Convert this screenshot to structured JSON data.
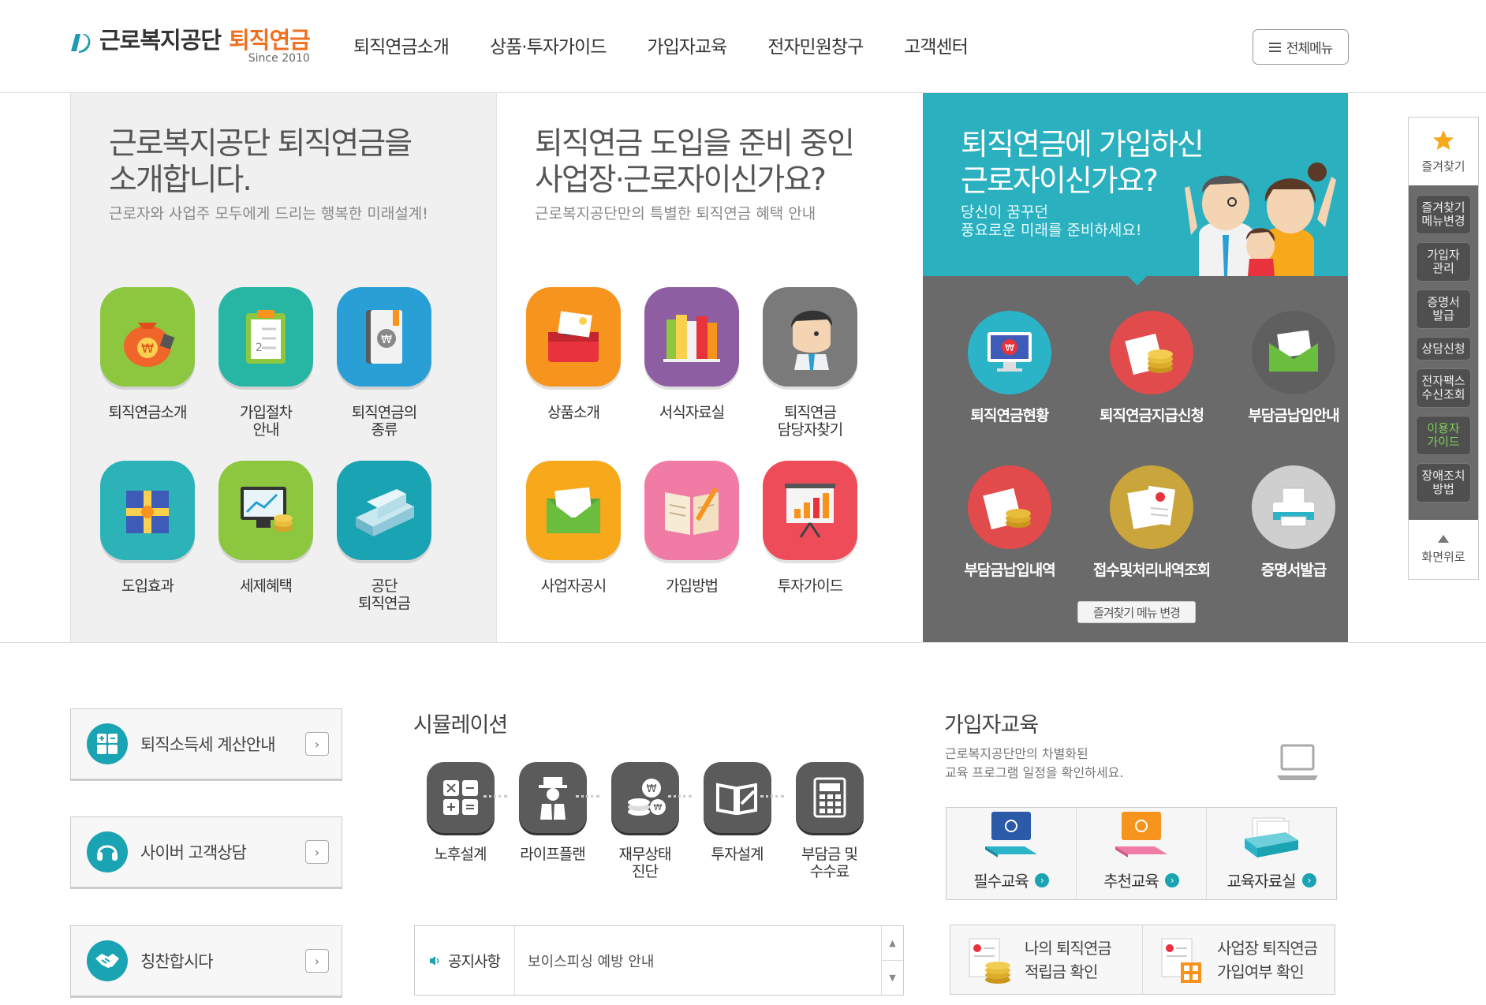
{
  "header": {
    "logo_org": "근로복지공단",
    "logo_brand": "퇴직연금",
    "logo_since": "Since 2010",
    "nav": [
      "퇴직연금소개",
      "상품·투자가이드",
      "가입자교육",
      "전자민원창구",
      "고객센터"
    ],
    "all_menu": "전체메뉴"
  },
  "panel1": {
    "title": "근로복지공단 퇴직연금을\n소개합니다.",
    "subtitle": "근로자와 사업주 모두에게 드리는 행복한 미래설계!",
    "items": [
      {
        "label": "퇴직연금소개",
        "icon": "money-bag-icon",
        "color": "#8dc63f"
      },
      {
        "label": "가입절차\n안내",
        "icon": "clipboard-icon",
        "color": "#27b6a4"
      },
      {
        "label": "퇴직연금의\n종류",
        "icon": "notebook-icon",
        "color": "#2a9fd6"
      },
      {
        "label": "도입효과",
        "icon": "gift-icon",
        "color": "#2bb3b8"
      },
      {
        "label": "세제혜택",
        "icon": "monitor-coins-icon",
        "color": "#8dc63f"
      },
      {
        "label": "공단\n퇴직연금",
        "icon": "building-icon",
        "color": "#1aa3b2"
      }
    ]
  },
  "panel2": {
    "title": "퇴직연금 도입을 준비 중인\n사업장·근로자이신가요?",
    "subtitle": "근로복지공단만의 특별한 퇴직연금 혜택 안내",
    "items": [
      {
        "label": "상품소개",
        "icon": "briefcase-icon",
        "color": "#f7941d"
      },
      {
        "label": "서식자료실",
        "icon": "books-icon",
        "color": "#8e5ea2"
      },
      {
        "label": "퇴직연금\n담당자찾기",
        "icon": "person-icon",
        "color": "#7a7a7a"
      },
      {
        "label": "사업자공시",
        "icon": "envelope-icon",
        "color": "#f7a81b"
      },
      {
        "label": "가입방법",
        "icon": "open-book-icon",
        "color": "#f07ba4"
      },
      {
        "label": "투자가이드",
        "icon": "chart-board-icon",
        "color": "#ee4c58"
      }
    ]
  },
  "panel3": {
    "title": "퇴직연금에 가입하신\n근로자이신가요?",
    "subtitle": "당신이 꿈꾸던\n풍요로운 미래를 준비하세요!",
    "items": [
      {
        "label": "퇴직연금현황",
        "icon": "monitor-won-icon",
        "color": "#2bb3c8"
      },
      {
        "label": "퇴직연금지급신청",
        "icon": "coin-stack-icon",
        "color": "#e24b4b"
      },
      {
        "label": "부담금납입안내",
        "icon": "envelope-icon",
        "color": "#5f5f5f"
      },
      {
        "label": "부담금납입내역",
        "icon": "coin-document-icon",
        "color": "#e24b4b"
      },
      {
        "label": "접수및처리내역조회",
        "icon": "certificate-icon",
        "color": "#c9a53b"
      },
      {
        "label": "증명서발급",
        "icon": "printer-icon",
        "color": "#cfcfcf"
      }
    ],
    "fav_change": "즐겨찾기 메뉴 변경"
  },
  "quickbar": {
    "fav": "즐겨찾기",
    "buttons": [
      "즐겨찾기\n메뉴변경",
      "가입자\n관리",
      "증명서\n발급",
      "상담신청",
      "전자팩스\n수신조회",
      "이용자\n가이드",
      "장애조치\n방법"
    ],
    "top": "화면위로"
  },
  "left_buttons": [
    {
      "label": "퇴직소득세 계산안내",
      "icon": "calculator-icon"
    },
    {
      "label": "사이버 고객상담",
      "icon": "headset-icon"
    },
    {
      "label": "칭찬합시다",
      "icon": "handshake-icon"
    }
  ],
  "simulation": {
    "title": "시뮬레이션",
    "items": [
      {
        "label": "노후설계",
        "icon": "calculator-icon"
      },
      {
        "label": "라이프플랜",
        "icon": "elder-person-icon"
      },
      {
        "label": "재무상태\n진단",
        "icon": "coins-icon"
      },
      {
        "label": "투자설계",
        "icon": "book-pen-icon"
      },
      {
        "label": "부담금 및\n수수료",
        "icon": "calculator-won-icon"
      }
    ]
  },
  "notice": {
    "label": "공지사항",
    "text": "보이스피싱 예방 안내"
  },
  "education": {
    "title": "가입자교육",
    "subtitle": "근로복지공단만의 차별화된\n교육 프로그램 일정을 확인하세요.",
    "items": [
      {
        "label": "필수교육",
        "icon": "monitor-blue-icon"
      },
      {
        "label": "추천교육",
        "icon": "monitor-orange-icon"
      },
      {
        "label": "교육자료실",
        "icon": "file-box-icon"
      }
    ],
    "accounts": [
      {
        "label": "나의 퇴직연금\n적립금 확인",
        "icon": "document-coins-icon"
      },
      {
        "label": "사업장 퇴직연금\n가입여부 확인",
        "icon": "document-building-icon"
      }
    ]
  }
}
